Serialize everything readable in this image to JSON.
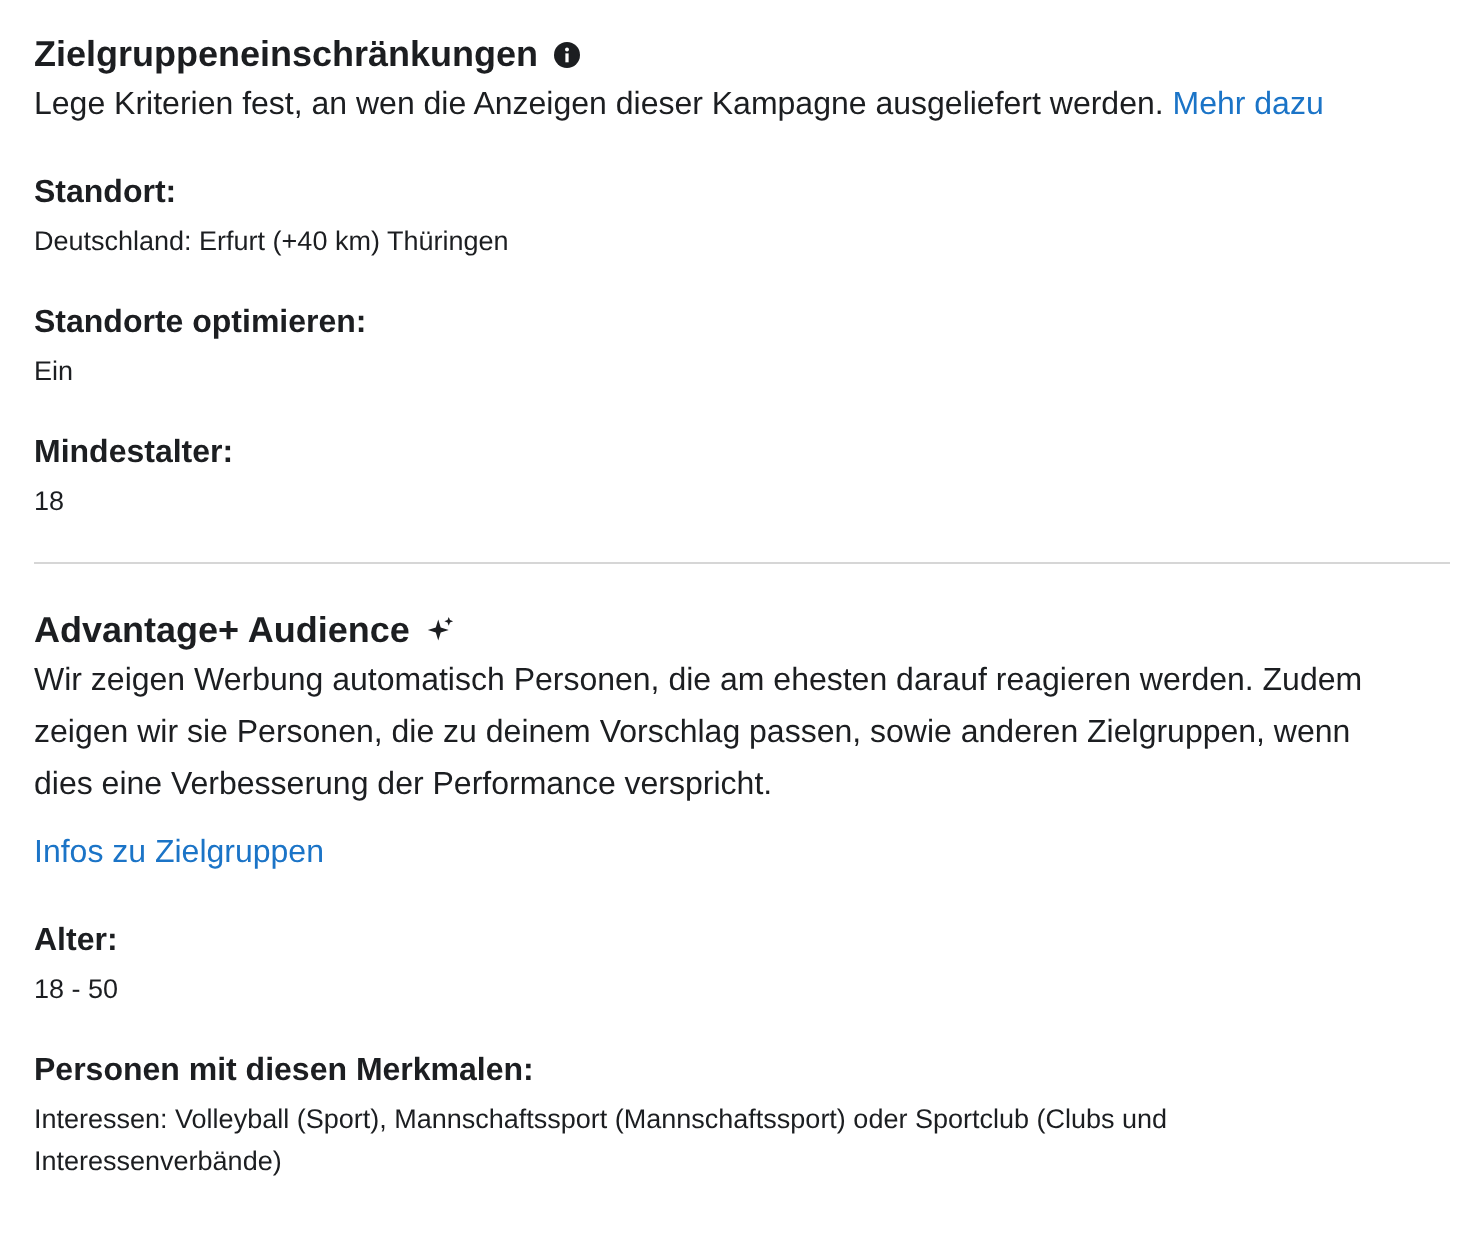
{
  "sections": [
    {
      "kind": "restrictions",
      "title": "Zielgruppeneinschränkungen",
      "description": "Lege Kriterien fest, an wen die Anzeigen dieser Kampagne ausgeliefert werden.",
      "link": "Mehr dazu",
      "fields": [
        {
          "label": "Standort:",
          "value": "Deutschland: Erfurt (+40 km) Thüringen"
        },
        {
          "label": "Standorte optimieren:",
          "value": "Ein"
        },
        {
          "label": "Mindestalter:",
          "value": "18"
        }
      ]
    },
    {
      "kind": "advantage",
      "title": "Advantage+ Audience",
      "description": "Wir zeigen Werbung automatisch Personen, die am ehesten darauf reagieren werden. Zudem zeigen wir sie Personen, die zu deinem Vorschlag passen, sowie anderen Zielgruppen, wenn dies eine Verbesserung der Performance verspricht.",
      "link": "Infos zu Zielgruppen",
      "fields": [
        {
          "label": "Alter:",
          "value": "18 - 50"
        },
        {
          "label": "Personen mit diesen Merkmalen:",
          "value": "Interessen: Volleyball (Sport), Mannschaftssport (Mannschaftssport) oder Sportclub (Clubs und Interessenverbände)"
        }
      ]
    }
  ]
}
